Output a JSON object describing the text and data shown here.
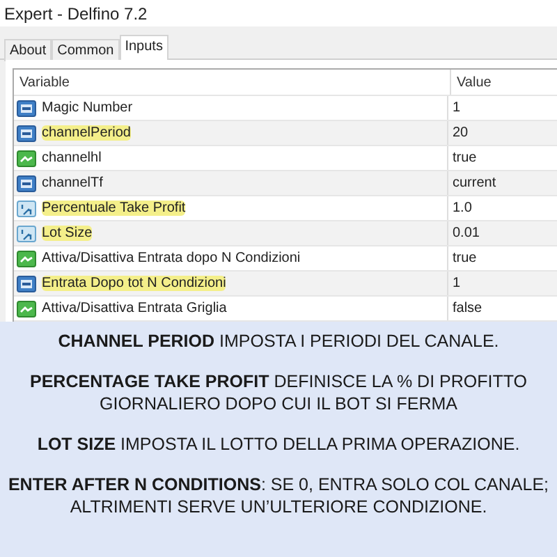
{
  "window": {
    "title": "Expert - Delfino 7.2"
  },
  "tabs": [
    {
      "label": "About",
      "selected": false
    },
    {
      "label": "Common",
      "selected": false
    },
    {
      "label": "Inputs",
      "selected": true
    }
  ],
  "table": {
    "columns": [
      "Variable",
      "Value"
    ],
    "rows": [
      {
        "kind": "int",
        "name": "Magic Number",
        "value": "1",
        "highlighted": false
      },
      {
        "kind": "int",
        "name": "channelPeriod",
        "value": "20",
        "highlighted": true
      },
      {
        "kind": "bool",
        "name": "channelhl",
        "value": "true",
        "highlighted": false
      },
      {
        "kind": "int",
        "name": "channelTf",
        "value": "current",
        "highlighted": false
      },
      {
        "kind": "double",
        "name": "Percentuale Take Profit",
        "value": "1.0",
        "highlighted": true
      },
      {
        "kind": "double",
        "name": "Lot Size",
        "value": "0.01",
        "highlighted": true
      },
      {
        "kind": "bool",
        "name": "Attiva/Disattiva Entrata dopo N Condizioni",
        "value": "true",
        "highlighted": false
      },
      {
        "kind": "int",
        "name": "Entrata Dopo tot N Condizioni",
        "value": "1",
        "highlighted": true
      },
      {
        "kind": "bool",
        "name": "Attiva/Disattiva Entrata Griglia",
        "value": "false",
        "highlighted": false
      }
    ]
  },
  "caption": {
    "paragraphs": [
      "**CHANNEL PERIOD** IMPOSTA I PERIODI DEL CANALE.",
      "**PERCENTAGE TAKE PROFIT** DEFINISCE LA % DI PROFITTO GIORNALIERO DOPO CUI IL BOT SI FERMA",
      "**LOT SIZE** IMPOSTA IL LOTTO DELLA PRIMA OPERAZIONE.",
      "**ENTER AFTER N CONDITIONS**: SE 0, ENTRA SOLO COL CANALE; ALTRIMENTI SERVE UN’ULTERIORE CONDIZIONE."
    ]
  }
}
